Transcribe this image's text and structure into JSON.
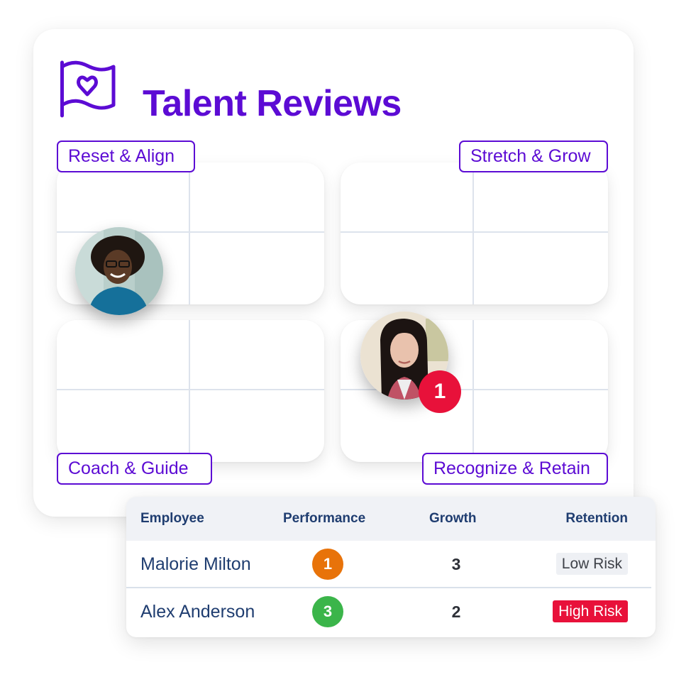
{
  "header": {
    "icon": "flag-heart-icon",
    "title": "Talent Reviews"
  },
  "colors": {
    "brand": "#5c0bd4",
    "grid_line": "#dde3ec",
    "alert_red": "#e8113a",
    "perf_orange": "#e8730a",
    "perf_green": "#3bb54a",
    "header_text": "#1f3d70"
  },
  "grid": {
    "quadrants": [
      {
        "id": "top-left",
        "label": "Reset & Align"
      },
      {
        "id": "top-right",
        "label": "Stretch & Grow"
      },
      {
        "id": "bottom-left",
        "label": "Coach & Guide"
      },
      {
        "id": "bottom-right",
        "label": "Recognize & Retain"
      }
    ],
    "avatars": [
      {
        "quadrant": "top-left",
        "icon": "person-photo-avatar"
      },
      {
        "quadrant": "bottom-right",
        "icon": "person-photo-avatar",
        "badge": "1"
      }
    ]
  },
  "table": {
    "columns": [
      "Employee",
      "Performance",
      "Growth",
      "Retention"
    ],
    "rows": [
      {
        "employee": "Malorie Milton",
        "performance": "1",
        "performance_color": "#e8730a",
        "growth": "3",
        "retention": "Low Risk",
        "retention_level": "low"
      },
      {
        "employee": "Alex Anderson",
        "performance": "3",
        "performance_color": "#3bb54a",
        "growth": "2",
        "retention": "High Risk",
        "retention_level": "high"
      }
    ]
  }
}
